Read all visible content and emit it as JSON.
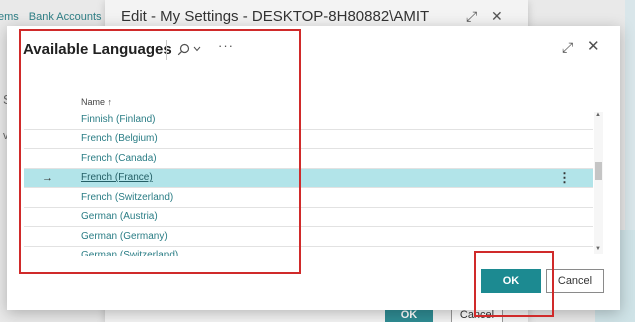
{
  "background": {
    "nav_items": [
      "ems",
      "Bank Accounts"
    ],
    "side_s": "S",
    "side_v": "v"
  },
  "edit_dialog": {
    "title": "Edit - My Settings - DESKTOP-8H80882\\AMIT",
    "expand_icon": "expand-icon",
    "close_icon": "close-icon",
    "ok_label": "OK",
    "cancel_label": "Cancel"
  },
  "lookup_dialog": {
    "title": "Available Languages",
    "search_icon": "search-icon",
    "more_label": "···",
    "column_header": "Name ↑",
    "rows": [
      {
        "label": "Finnish (Finland)",
        "selected": false
      },
      {
        "label": "French (Belgium)",
        "selected": false
      },
      {
        "label": "French (Canada)",
        "selected": false
      },
      {
        "label": "French (France)",
        "selected": true
      },
      {
        "label": "French (Switzerland)",
        "selected": false
      },
      {
        "label": "German (Austria)",
        "selected": false
      },
      {
        "label": "German (Germany)",
        "selected": false
      },
      {
        "label": "German (Switzerland)",
        "selected": false
      }
    ],
    "row_arrow": "→",
    "row_menu": "⋮",
    "ok_label": "OK",
    "cancel_label": "Cancel"
  },
  "colors": {
    "accent": "#1c8a91",
    "selected_row": "#b2e4e9",
    "link_text": "#2a7d85",
    "highlight_box": "#d02a2a"
  }
}
